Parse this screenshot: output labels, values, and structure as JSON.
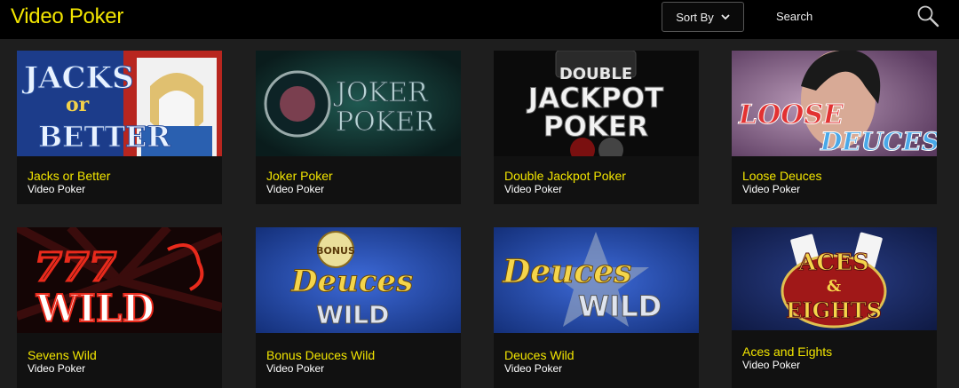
{
  "header": {
    "title": "Video Poker",
    "sort_label": "Sort By",
    "search_label": "Search"
  },
  "games": [
    {
      "name": "Jacks or Better",
      "category": "Video Poker",
      "art_text": [
        "JACKS",
        "or",
        "BETTER"
      ]
    },
    {
      "name": "Joker Poker",
      "category": "Video Poker",
      "art_text": [
        "JOKER",
        "POKER"
      ]
    },
    {
      "name": "Double Jackpot Poker",
      "category": "Video Poker",
      "art_text": [
        "DOUBLE",
        "JACKPOT",
        "POKER"
      ]
    },
    {
      "name": "Loose Deuces",
      "category": "Video Poker",
      "art_text": [
        "LOOSE",
        "DEUCES"
      ]
    },
    {
      "name": "Sevens Wild",
      "category": "Video Poker",
      "art_text": [
        "777",
        "WILD"
      ]
    },
    {
      "name": "Bonus Deuces Wild",
      "category": "Video Poker",
      "art_text": [
        "BONUS",
        "Deuces",
        "WILD"
      ]
    },
    {
      "name": "Deuces Wild",
      "category": "Video Poker",
      "art_text": [
        "Deuces",
        "WILD"
      ]
    },
    {
      "name": "Aces and Eights",
      "category": "Video Poker",
      "art_text": [
        "ACES",
        "&",
        "EIGHTS"
      ]
    }
  ],
  "colors": {
    "accent": "#f2e500",
    "background": "#1e1e1e",
    "header_bg": "#000000"
  }
}
